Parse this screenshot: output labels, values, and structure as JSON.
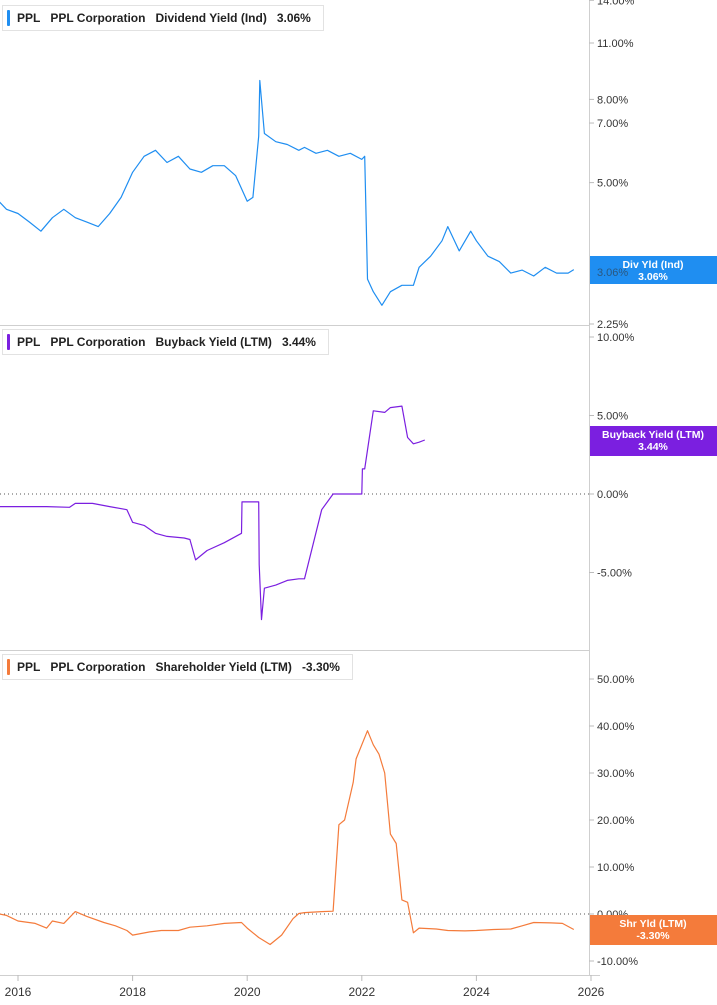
{
  "colors": {
    "div": "#1f8ef1",
    "buyback": "#7b1fe0",
    "shareholder": "#f47b3b"
  },
  "legends": [
    {
      "ticker": "PPL",
      "company": "PPL Corporation",
      "metric": "Dividend Yield (Ind)",
      "value": "3.06%"
    },
    {
      "ticker": "PPL",
      "company": "PPL Corporation",
      "metric": "Buyback Yield (LTM)",
      "value": "3.44%"
    },
    {
      "ticker": "PPL",
      "company": "PPL Corporation",
      "metric": "Shareholder Yield (LTM)",
      "value": "-3.30%"
    }
  ],
  "badges": [
    {
      "name": "Div Yld (Ind)",
      "value": "3.06%",
      "panel_label": "3.06%"
    },
    {
      "name": "Buyback Yield (LTM)",
      "value": "3.44%"
    },
    {
      "name": "Shr Yld (LTM)",
      "value": "-3.30%"
    }
  ],
  "chart_data": [
    {
      "type": "line",
      "title": "PPL Corporation Dividend Yield (Ind)",
      "scale": "log",
      "yticks": [
        "14.00%",
        "11.00%",
        "8.00%",
        "7.00%",
        "5.00%",
        "2.25%"
      ],
      "ytick_values": [
        14,
        11,
        8,
        7,
        5,
        2.25
      ],
      "ylim": [
        2.25,
        14
      ],
      "xlim": [
        2015.6,
        2026
      ],
      "x": [
        2015.6,
        2015.8,
        2016.0,
        2016.2,
        2016.4,
        2016.6,
        2016.8,
        2017.0,
        2017.2,
        2017.4,
        2017.6,
        2017.8,
        2018.0,
        2018.2,
        2018.4,
        2018.6,
        2018.8,
        2019.0,
        2019.2,
        2019.4,
        2019.6,
        2019.8,
        2020.0,
        2020.1,
        2020.2,
        2020.22,
        2020.3,
        2020.5,
        2020.7,
        2020.9,
        2021.0,
        2021.2,
        2021.4,
        2021.6,
        2021.8,
        2022.0,
        2022.05,
        2022.1,
        2022.2,
        2022.35,
        2022.5,
        2022.7,
        2022.9,
        2023.0,
        2023.2,
        2023.4,
        2023.5,
        2023.7,
        2023.9,
        2024.0,
        2024.2,
        2024.4,
        2024.6,
        2024.8,
        2025.0,
        2025.2,
        2025.4,
        2025.6,
        2025.7
      ],
      "y": [
        4.6,
        4.3,
        4.2,
        4.0,
        3.8,
        4.1,
        4.3,
        4.1,
        4.0,
        3.9,
        4.2,
        4.6,
        5.3,
        5.8,
        6.0,
        5.6,
        5.8,
        5.4,
        5.3,
        5.5,
        5.5,
        5.2,
        4.5,
        4.6,
        6.5,
        8.9,
        6.6,
        6.3,
        6.2,
        6.0,
        6.1,
        5.9,
        6.0,
        5.8,
        5.9,
        5.7,
        5.8,
        2.9,
        2.7,
        2.5,
        2.7,
        2.8,
        2.8,
        3.1,
        3.3,
        3.6,
        3.9,
        3.4,
        3.8,
        3.6,
        3.3,
        3.2,
        3.0,
        3.05,
        2.95,
        3.1,
        3.0,
        3.0,
        3.06
      ],
      "series_name": "Div Yld (Ind)"
    },
    {
      "type": "line",
      "title": "PPL Corporation Buyback Yield (LTM)",
      "yticks": [
        "10.00%",
        "5.00%",
        "0.00%",
        "-5.00%"
      ],
      "ytick_values": [
        10,
        5,
        0,
        -5
      ],
      "ylim": [
        -8,
        10
      ],
      "xlim": [
        2015.6,
        2026
      ],
      "x": [
        2015.6,
        2016.0,
        2016.5,
        2016.9,
        2017.0,
        2017.3,
        2017.6,
        2017.9,
        2018.0,
        2018.2,
        2018.4,
        2018.6,
        2018.9,
        2019.0,
        2019.1,
        2019.3,
        2019.6,
        2019.9,
        2019.91,
        2020.2,
        2020.21,
        2020.25,
        2020.3,
        2020.5,
        2020.7,
        2020.9,
        2021.0,
        2021.3,
        2021.5,
        2021.6,
        2021.7,
        2022.0,
        2022.01,
        2022.05,
        2022.2,
        2022.4,
        2022.5,
        2022.7,
        2022.8,
        2022.9,
        2023.0,
        2023.1
      ],
      "y": [
        -0.8,
        -0.8,
        -0.8,
        -0.85,
        -0.6,
        -0.6,
        -0.8,
        -1.0,
        -1.8,
        -2.0,
        -2.5,
        -2.7,
        -2.8,
        -2.9,
        -4.2,
        -3.6,
        -3.1,
        -2.5,
        -0.5,
        -0.5,
        -4.5,
        -8.0,
        -6.0,
        -5.8,
        -5.5,
        -5.4,
        -5.4,
        -1.0,
        0.0,
        0.0,
        0.0,
        0.0,
        1.6,
        1.6,
        5.3,
        5.2,
        5.5,
        5.6,
        3.6,
        3.2,
        3.3,
        3.44
      ],
      "series_name": "Buyback Yield (LTM)"
    },
    {
      "type": "line",
      "title": "PPL Corporation Shareholder Yield (LTM)",
      "yticks": [
        "50.00%",
        "40.00%",
        "30.00%",
        "20.00%",
        "10.00%",
        "0.00%",
        "-10.00%"
      ],
      "ytick_values": [
        50,
        40,
        30,
        20,
        10,
        0,
        -10
      ],
      "ylim": [
        -12,
        55
      ],
      "xlim": [
        2015.6,
        2026
      ],
      "x": [
        2015.6,
        2015.8,
        2016.0,
        2016.3,
        2016.5,
        2016.6,
        2016.8,
        2017.0,
        2017.2,
        2017.5,
        2017.7,
        2017.9,
        2018.0,
        2018.3,
        2018.5,
        2018.8,
        2019.0,
        2019.3,
        2019.6,
        2019.9,
        2020.0,
        2020.2,
        2020.4,
        2020.6,
        2020.8,
        2020.9,
        2021.0,
        2021.3,
        2021.5,
        2021.6,
        2021.7,
        2021.85,
        2021.9,
        2022.1,
        2022.2,
        2022.3,
        2022.4,
        2022.5,
        2022.6,
        2022.7,
        2022.8,
        2022.9,
        2023.0,
        2023.3,
        2023.5,
        2023.8,
        2024.0,
        2024.3,
        2024.6,
        2024.8,
        2025.0,
        2025.3,
        2025.5,
        2025.7
      ],
      "y": [
        0.2,
        -0.3,
        -1.5,
        -2.0,
        -3.0,
        -1.5,
        -2.0,
        0.5,
        -0.5,
        -1.8,
        -2.5,
        -3.5,
        -4.5,
        -3.8,
        -3.5,
        -3.5,
        -2.8,
        -2.5,
        -2.0,
        -1.8,
        -3.0,
        -5.0,
        -6.5,
        -4.5,
        -1.0,
        0.1,
        0.3,
        0.5,
        0.6,
        19.0,
        20.0,
        28.0,
        33.0,
        39.0,
        36.0,
        34.0,
        30.0,
        17.0,
        15.0,
        3.0,
        2.5,
        -4.0,
        -3.0,
        -3.2,
        -3.5,
        -3.6,
        -3.5,
        -3.3,
        -3.2,
        -2.5,
        -1.8,
        -1.9,
        -2.0,
        -3.3
      ],
      "series_name": "Shr Yld (LTM)"
    }
  ],
  "xaxis": {
    "ticks": [
      "2016",
      "2018",
      "2020",
      "2022",
      "2024",
      "2026"
    ],
    "tick_values": [
      2016,
      2018,
      2020,
      2022,
      2024,
      2026
    ]
  }
}
